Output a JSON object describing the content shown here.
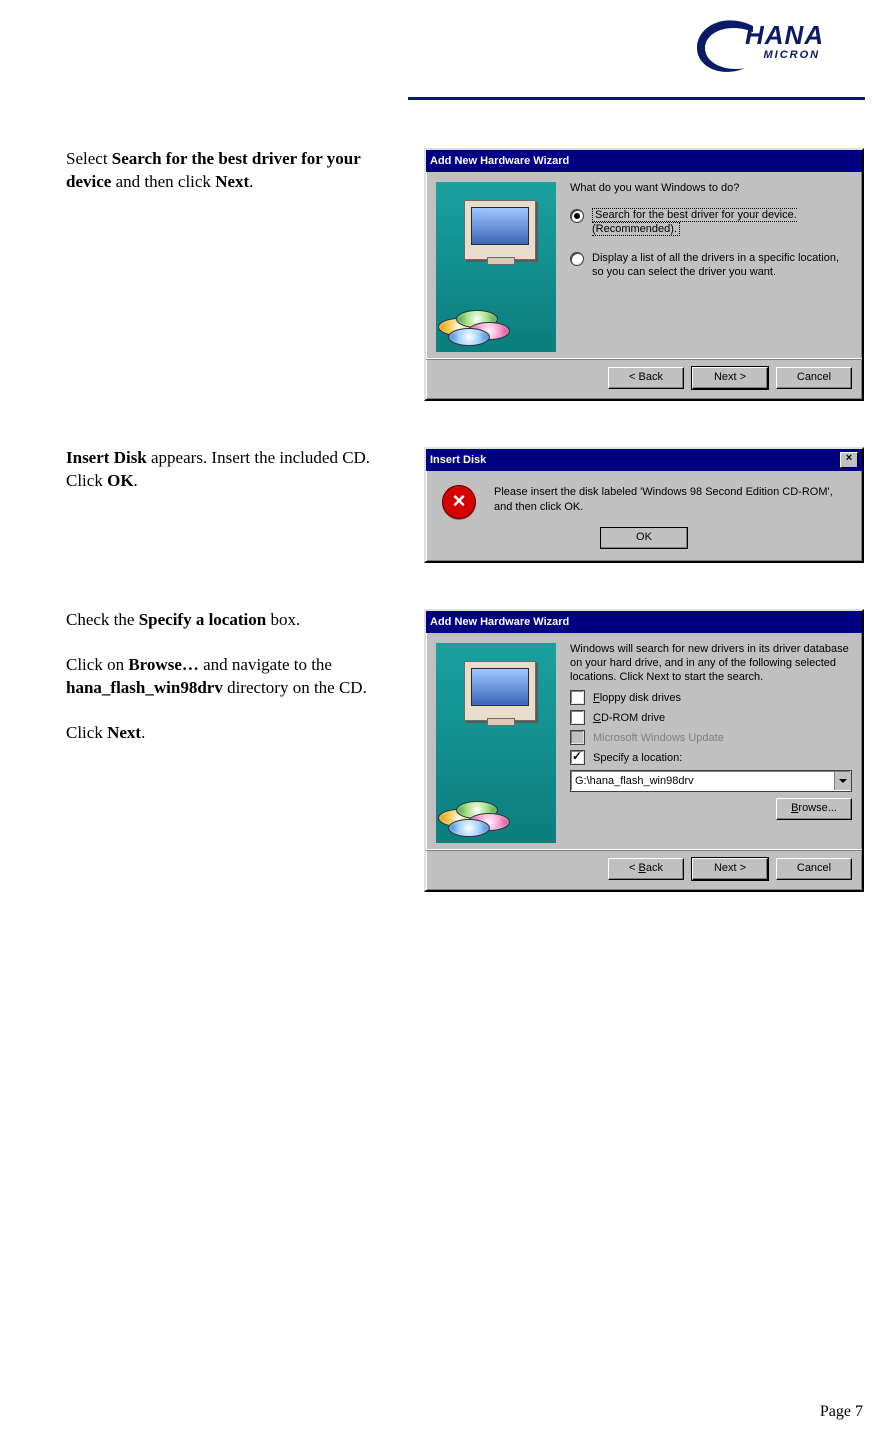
{
  "logo": {
    "line1": "HANA",
    "line2": "MICRON"
  },
  "sec1": {
    "instr_parts": [
      "Select ",
      "Search for the best driver for your device",
      " and then click ",
      "Next",
      "."
    ],
    "title": "Add New Hardware Wizard",
    "prompt": "What do you want Windows to do?",
    "opt1": "Search for the best driver for your device. (Recommended).",
    "opt2": "Display a list of all the drivers in a specific location, so you can select the driver you want.",
    "back": "< Back",
    "next": "Next >",
    "cancel": "Cancel"
  },
  "sec2": {
    "instr_parts": [
      "Insert Disk",
      " appears.  Insert the included CD.  Click ",
      "OK",
      "."
    ],
    "title": "Insert Disk",
    "msg": "Please insert the disk labeled 'Windows 98 Second Edition CD-ROM', and then click OK.",
    "ok": "OK"
  },
  "sec3": {
    "i1": [
      "Check the ",
      "Specify a location",
      " box."
    ],
    "i2": [
      "Click on ",
      "Browse…",
      " and navigate to the ",
      "hana_flash_win98drv",
      " directory on the CD."
    ],
    "i3": [
      "Click ",
      "Next",
      "."
    ],
    "title": "Add New Hardware Wizard",
    "desc": "Windows will search for new drivers in its driver database on your hard drive, and in any of the following selected locations. Click Next to start the search.",
    "floppy_pre": "F",
    "floppy_rest": "loppy disk drives",
    "cdrom_pre": "C",
    "cdrom_rest": "D-ROM drive",
    "msupdate": "Microsoft Windows Update",
    "specify": "Specify a location:",
    "path": "G:\\hana_flash_win98drv",
    "browse_pre": "B",
    "browse_rest": "rowse...",
    "back_pre": "B",
    "back_rest": "ack",
    "back_lt": "< ",
    "next": "Next >",
    "cancel": "Cancel"
  },
  "footer": "Page 7"
}
